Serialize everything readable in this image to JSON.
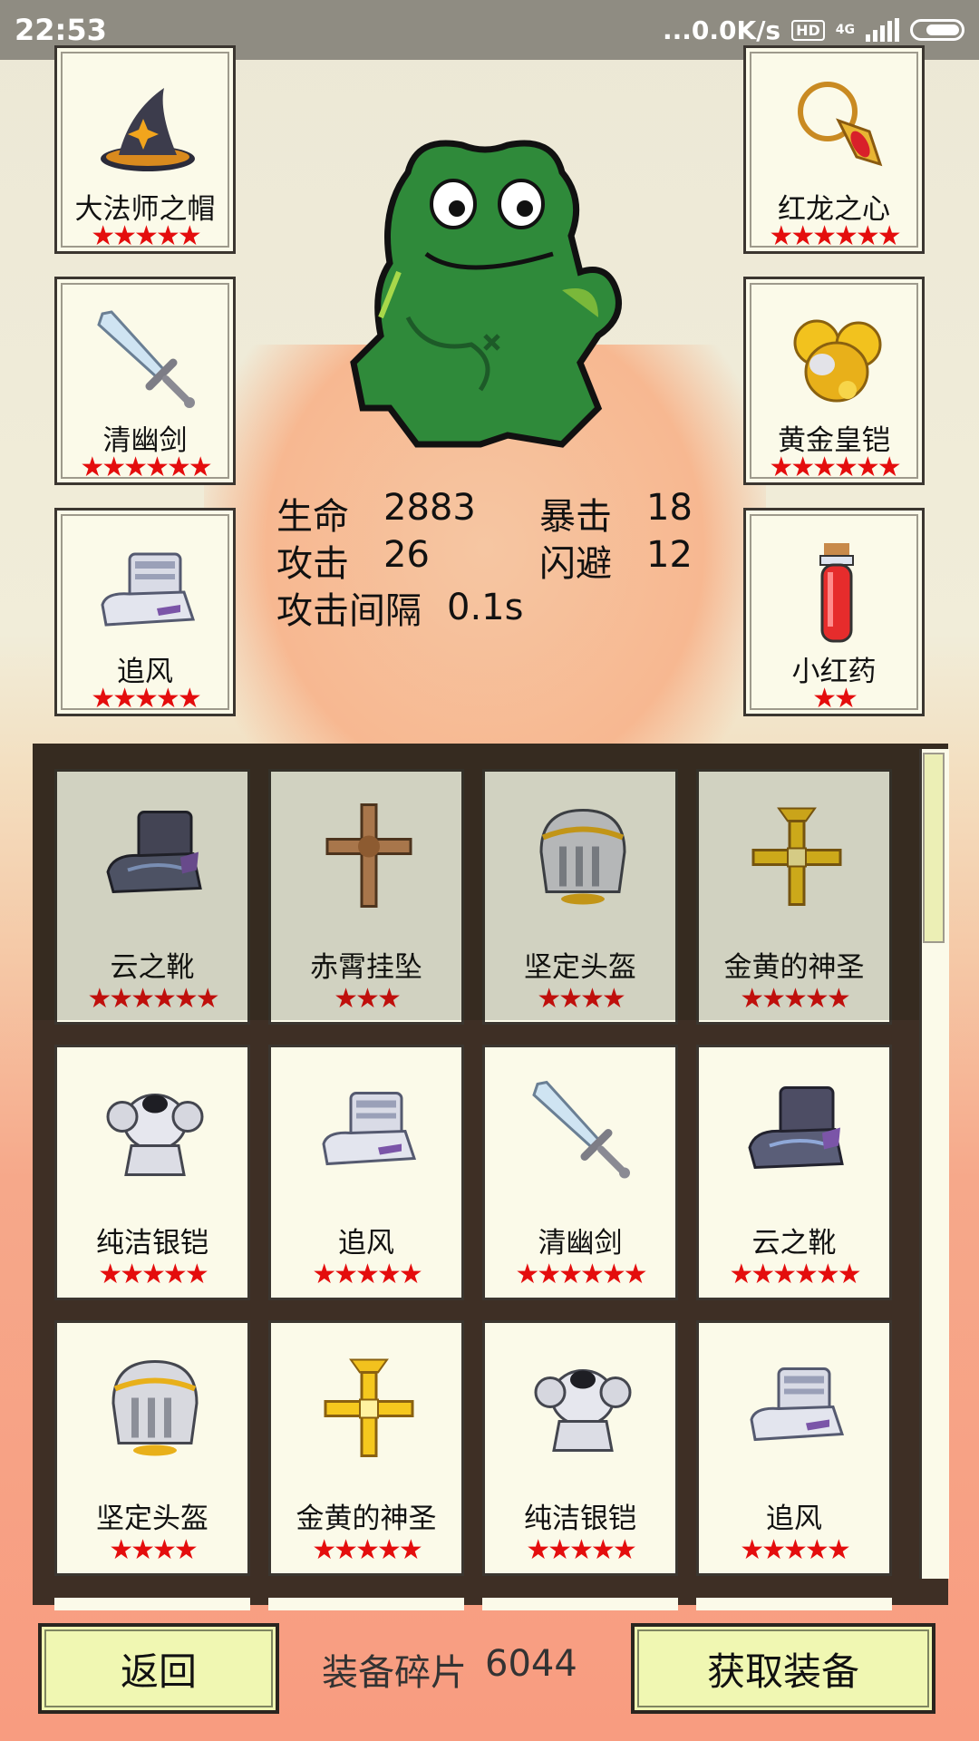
{
  "status_bar": {
    "time": "22:53",
    "network_speed": "...0.0K/s",
    "hd_badge": "HD",
    "network_type": "4G"
  },
  "hero": {
    "stats": [
      {
        "label": "生命",
        "value": "2883"
      },
      {
        "label": "暴击",
        "value": "18"
      },
      {
        "label": "攻击",
        "value": "26"
      },
      {
        "label": "闪避",
        "value": "12"
      },
      {
        "label": "攻击间隔",
        "value": "0.1s"
      }
    ]
  },
  "equipped": {
    "left": [
      {
        "name": "大法师之帽",
        "stars": "★★★★★",
        "icon": "wizard-hat-icon"
      },
      {
        "name": "清幽剑",
        "stars": "★★★★★★",
        "icon": "sword-icon"
      },
      {
        "name": "追风",
        "stars": "★★★★★",
        "icon": "silver-boots-icon"
      }
    ],
    "right": [
      {
        "name": "红龙之心",
        "stars": "★★★★★★",
        "icon": "amulet-icon"
      },
      {
        "name": "黄金皇铠",
        "stars": "★★★★★★",
        "icon": "golden-armor-icon"
      },
      {
        "name": "小红药",
        "stars": "★★",
        "icon": "red-potion-icon"
      }
    ]
  },
  "inventory": {
    "items": [
      {
        "name": "云之靴",
        "stars": "★★★★★★",
        "icon": "dark-boots-icon"
      },
      {
        "name": "赤霄挂坠",
        "stars": "★★★",
        "icon": "bronze-cross-pendant-icon"
      },
      {
        "name": "坚定头盔",
        "stars": "★★★★",
        "icon": "helmet-icon"
      },
      {
        "name": "金黄的神圣",
        "stars": "★★★★★",
        "icon": "gold-cross-pendant-icon"
      },
      {
        "name": "纯洁银铠",
        "stars": "★★★★★",
        "icon": "silver-armor-icon"
      },
      {
        "name": "追风",
        "stars": "★★★★★",
        "icon": "silver-boots-icon"
      },
      {
        "name": "清幽剑",
        "stars": "★★★★★★",
        "icon": "sword-icon"
      },
      {
        "name": "云之靴",
        "stars": "★★★★★★",
        "icon": "dark-boots-icon"
      },
      {
        "name": "坚定头盔",
        "stars": "★★★★",
        "icon": "helmet-icon"
      },
      {
        "name": "金黄的神圣",
        "stars": "★★★★★",
        "icon": "gold-cross-pendant-icon"
      },
      {
        "name": "纯洁银铠",
        "stars": "★★★★★",
        "icon": "silver-armor-icon"
      },
      {
        "name": "追风",
        "stars": "★★★★★",
        "icon": "silver-boots-icon"
      }
    ]
  },
  "bottom": {
    "back_label": "返回",
    "fragments_label": "装备碎片",
    "fragments_value": "6044",
    "get_label": "获取装备"
  }
}
